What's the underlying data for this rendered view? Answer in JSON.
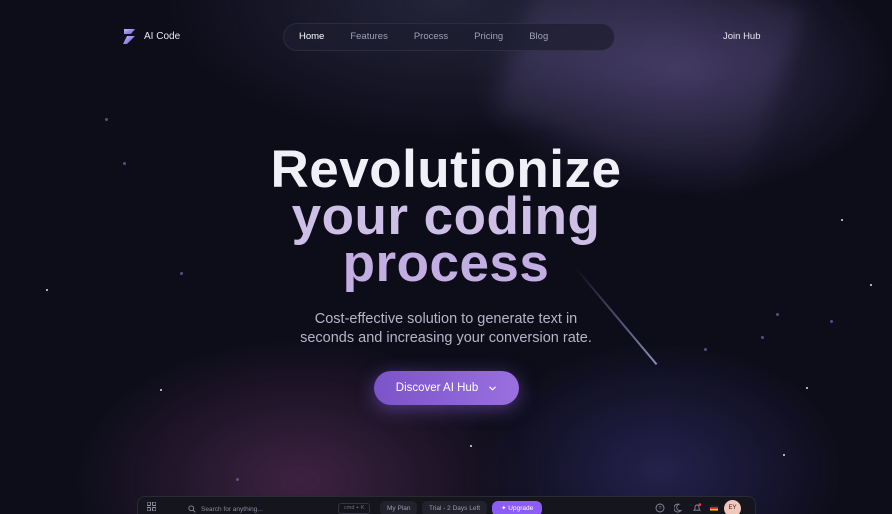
{
  "brand": {
    "name": "AI Code",
    "accent": "#8b5cf6"
  },
  "nav": {
    "items": [
      {
        "label": "Home",
        "active": true
      },
      {
        "label": "Features",
        "active": false
      },
      {
        "label": "Process",
        "active": false
      },
      {
        "label": "Pricing",
        "active": false
      },
      {
        "label": "Blog",
        "active": false
      }
    ],
    "join_label": "Join Hub"
  },
  "hero": {
    "title_line1": "Revolutionize",
    "title_line2": "your coding",
    "title_line3": "process",
    "subtitle_line1": "Cost-effective solution to generate text in",
    "subtitle_line2": "seconds and increasing your conversion rate.",
    "cta_label": "Discover AI Hub"
  },
  "app_bar": {
    "search_placeholder": "Search for anything...",
    "shortcut": "cmd + K",
    "plan_label": "My Plan",
    "trial_label": "Trial - 2 Days Left",
    "upgrade_label": "Upgrade",
    "avatar_initials": "EY"
  },
  "icons": {
    "logo": "bolt-logo-icon",
    "cta": "chevron-down-icon",
    "apps": "grid-icon",
    "search": "search-icon",
    "help": "help-icon",
    "theme": "moon-icon",
    "notifications": "bell-icon",
    "language": "flag-icon"
  }
}
